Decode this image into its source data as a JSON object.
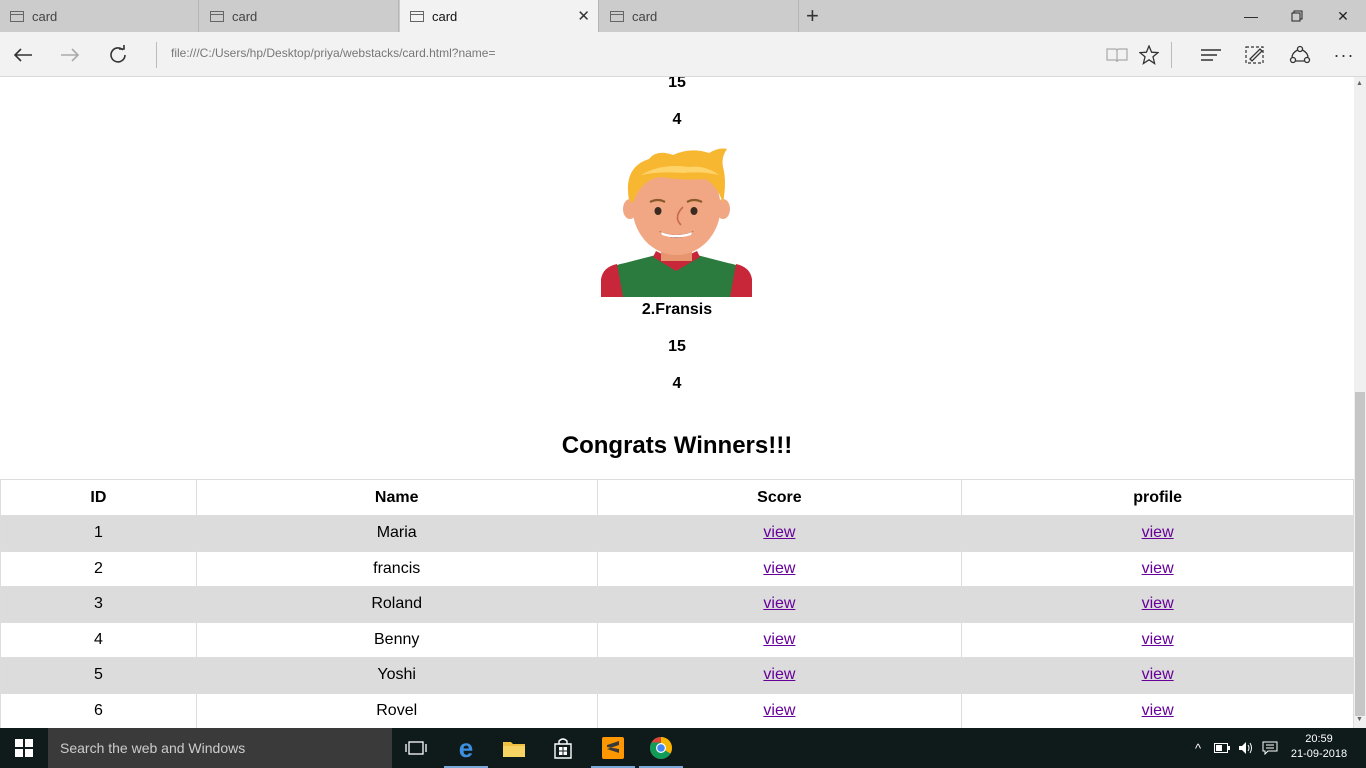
{
  "browser": {
    "tabs": [
      {
        "label": "card"
      },
      {
        "label": "card"
      },
      {
        "label": "card"
      },
      {
        "label": "card"
      }
    ],
    "active_tab_index": 2,
    "url": "file:///C:/Users/hp/Desktop/priya/webstacks/card.html?name="
  },
  "page": {
    "card_above": {
      "score": "15",
      "rank": "4"
    },
    "card": {
      "name": "2.Fransis",
      "score": "15",
      "rank": "4"
    },
    "heading": "Congrats Winners!!!",
    "table": {
      "headers": [
        "ID",
        "Name",
        "Score",
        "profile"
      ],
      "rows": [
        {
          "id": "1",
          "name": "Maria",
          "score_link": "view",
          "profile_link": "view"
        },
        {
          "id": "2",
          "name": "francis",
          "score_link": "view",
          "profile_link": "view"
        },
        {
          "id": "3",
          "name": "Roland",
          "score_link": "view",
          "profile_link": "view"
        },
        {
          "id": "4",
          "name": "Benny",
          "score_link": "view",
          "profile_link": "view"
        },
        {
          "id": "5",
          "name": "Yoshi",
          "score_link": "view",
          "profile_link": "view"
        },
        {
          "id": "6",
          "name": "Rovel",
          "score_link": "view",
          "profile_link": "view"
        }
      ]
    }
  },
  "taskbar": {
    "search_placeholder": "Search the web and Windows",
    "time": "20:59",
    "date": "21-09-2018"
  },
  "colors": {
    "link": "#660099",
    "row_alt": "#dcdcdc",
    "taskbar": "#0f1a1a"
  }
}
